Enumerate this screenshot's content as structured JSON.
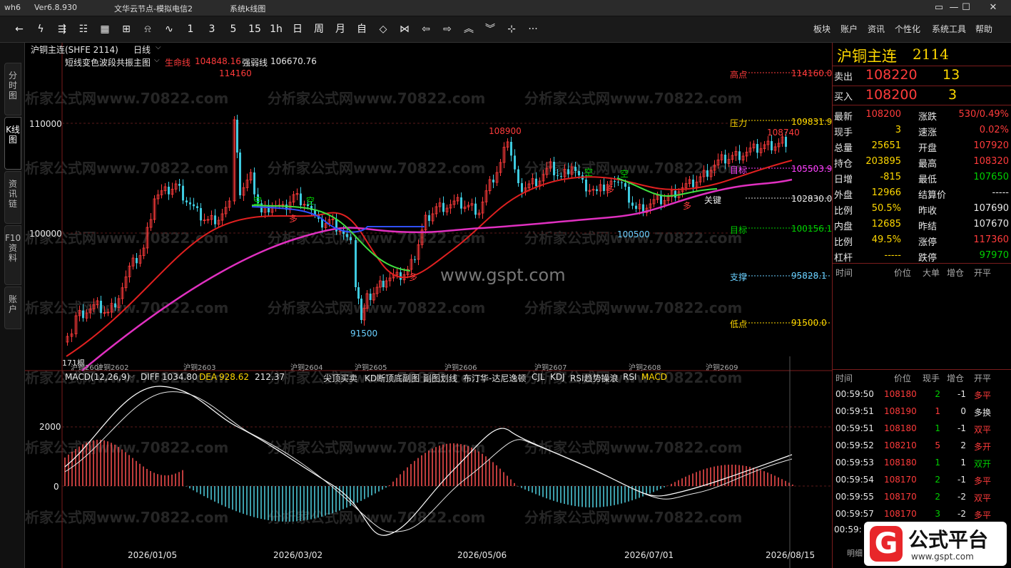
{
  "window": {
    "app": "wh6",
    "version": "Ver6.8.930",
    "node": "文华云节点-模拟电信2",
    "mode": "系统k线图"
  },
  "toolbar": {
    "periods": [
      "1",
      "3",
      "5",
      "15",
      "1h",
      "日",
      "周",
      "月"
    ],
    "menus": [
      "板块",
      "账户",
      "资讯",
      "个性化",
      "系统工具",
      "帮助"
    ]
  },
  "left_tabs": [
    "分时图",
    "K线图",
    "资讯链",
    "F10资料",
    "账户"
  ],
  "chart_header": {
    "symbol": "沪铜主连(SHFE 2114)",
    "period": "日线",
    "indicator_name": "短线变色波段共振主图",
    "life_line_label": "生命线",
    "life_line_value": "104848.16",
    "strong_line_label": "强弱线",
    "strong_line_value": "106670.76"
  },
  "price_axis": {
    "labels": [
      "110000",
      "100000"
    ]
  },
  "annotations": {
    "high_label": "高点",
    "high_value": "114160.0",
    "pressure_label": "压力",
    "pressure_value": "109831.9",
    "target1_label": "目标",
    "target1_value": "105503.9",
    "key_label": "关键",
    "key_value": "102830.0",
    "target2_label": "目标",
    "target2_value": "100156.1",
    "support_label": "支撑",
    "support_value": "95828.1",
    "low_label": "低点",
    "low_value": "91500.0",
    "peak1": "114160",
    "peak2": "108900",
    "peak3": "108740",
    "trough1": "91500",
    "trough2": "100500",
    "sig_kong": "空",
    "sig_duo": "多",
    "count_label": "171根"
  },
  "watermark": {
    "repeat": "分析家公式网www.70822.com",
    "center": "www.gspt.com"
  },
  "contract_labels": [
    "沪铜2601",
    "沪铜2602",
    "沪铜2603",
    "沪铜2604",
    "沪铜2605",
    "沪铜2606",
    "沪铜2607",
    "沪铜2608",
    "沪铜2609"
  ],
  "date_axis": [
    "2026/01/05",
    "2026/03/02",
    "2026/05/06",
    "2026/07/01",
    "2026/08/15"
  ],
  "macd": {
    "title": "MACD(12,26,9)",
    "diff_label": "DIFF",
    "diff_value": "1034.80",
    "dea_label": "DEA",
    "dea_value": "928.62",
    "macd_value": "212.37",
    "axis_labels": [
      "2000",
      "0"
    ],
    "tabs": [
      "尖顶买卖",
      "KD断顶底副图",
      "副图划线",
      "布汀华-达尼逸顿",
      "CJL",
      "KDJ",
      "RSI趋势操浪",
      "RSI",
      "MACD"
    ]
  },
  "quote": {
    "name": "沪铜主连",
    "code": "2114",
    "sell_label": "卖出",
    "sell_price": "108220",
    "sell_vol": "13",
    "buy_label": "买入",
    "buy_price": "108200",
    "buy_vol": "3",
    "rows": [
      {
        "l1": "最新",
        "v1": "108200",
        "c1": "red",
        "l2": "涨跌",
        "v2": "530/0.49%",
        "c2": "red"
      },
      {
        "l1": "现手",
        "v1": "3",
        "c1": "yel",
        "l2": "速涨",
        "v2": "0.02%",
        "c2": "red"
      },
      {
        "l1": "总量",
        "v1": "25651",
        "c1": "yel",
        "l2": "开盘",
        "v2": "107920",
        "c2": "red"
      },
      {
        "l1": "持仓",
        "v1": "203895",
        "c1": "yel",
        "l2": "最高",
        "v2": "108320",
        "c2": "red"
      },
      {
        "l1": "日增",
        "v1": "-815",
        "c1": "yel",
        "l2": "最低",
        "v2": "107650",
        "c2": "grn"
      },
      {
        "l1": "外盘",
        "v1": "12966",
        "c1": "yel",
        "l2": "结算价",
        "v2": "-----",
        "c2": "wht"
      },
      {
        "l1": "比例",
        "v1": "50.5%",
        "c1": "yel",
        "l2": "昨收",
        "v2": "107690",
        "c2": "wht"
      },
      {
        "l1": "内盘",
        "v1": "12685",
        "c1": "yel",
        "l2": "昨结",
        "v2": "107670",
        "c2": "wht"
      },
      {
        "l1": "比例",
        "v1": "49.5%",
        "c1": "yel",
        "l2": "涨停",
        "v2": "117360",
        "c2": "red"
      },
      {
        "l1": "杠杆",
        "v1": "-----",
        "c1": "yel",
        "l2": "跌停",
        "v2": "97970",
        "c2": "grn"
      }
    ],
    "tick_headers": [
      "时间",
      "价位",
      "大单",
      "增仓",
      "开平"
    ]
  },
  "ticks": {
    "headers": [
      "时间",
      "价位",
      "现手",
      "增仓",
      "开平"
    ],
    "rows": [
      {
        "t": "00:59:50",
        "p": "108180",
        "v": "2",
        "oi": "-1",
        "type": "多平",
        "vc": "grn",
        "oc": "red"
      },
      {
        "t": "00:59:51",
        "p": "108190",
        "v": "1",
        "oi": "0",
        "type": "多换",
        "vc": "red",
        "oc": "wht"
      },
      {
        "t": "00:59:51",
        "p": "108180",
        "v": "1",
        "oi": "-1",
        "type": "双平",
        "vc": "grn",
        "oc": "red"
      },
      {
        "t": "00:59:52",
        "p": "108210",
        "v": "5",
        "oi": "2",
        "type": "多开",
        "vc": "red",
        "oc": "red"
      },
      {
        "t": "00:59:53",
        "p": "108180",
        "v": "1",
        "oi": "1",
        "type": "双开",
        "vc": "grn",
        "oc": "grn"
      },
      {
        "t": "00:59:54",
        "p": "108170",
        "v": "2",
        "oi": "-1",
        "type": "多平",
        "vc": "grn",
        "oc": "red"
      },
      {
        "t": "00:59:55",
        "p": "108170",
        "v": "2",
        "oi": "-2",
        "type": "双平",
        "vc": "grn",
        "oc": "red"
      },
      {
        "t": "00:59:57",
        "p": "108170",
        "v": "3",
        "oi": "-2",
        "type": "多平",
        "vc": "grn",
        "oc": "red"
      }
    ],
    "partial_time": "00:59:"
  },
  "badge": {
    "name": "公式平台",
    "url": "www.gspt.com",
    "tab": "明细"
  }
}
